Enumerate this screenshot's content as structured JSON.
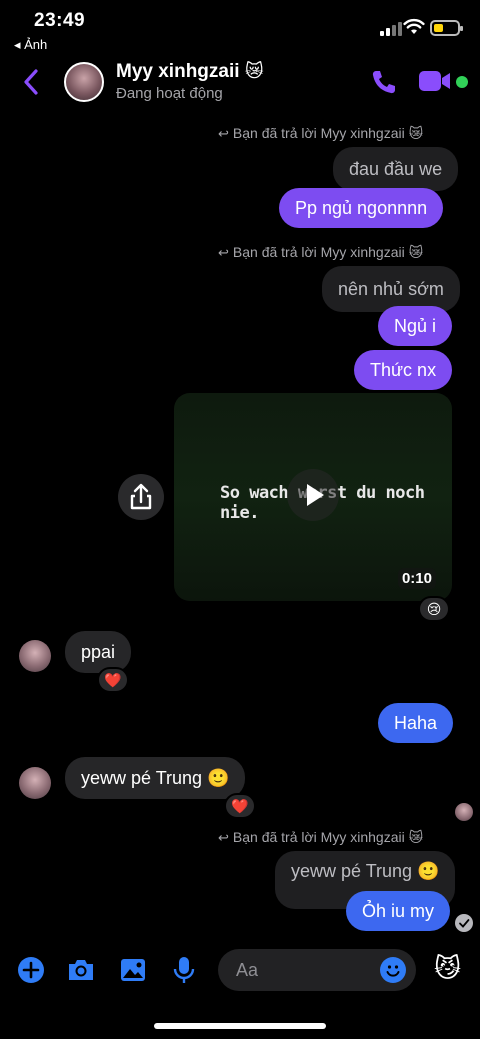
{
  "status_bar": {
    "time": "23:49",
    "back_app": "◂ Ảnh"
  },
  "header": {
    "contact_name": "Myy xinhgzaii",
    "contact_emoji": "😿",
    "contact_status": "Đang hoạt động",
    "accent_color": "#8a4dfc"
  },
  "messages": {
    "reply1_label": "Bạn đã trả lời Myy xinhgzaii 😿",
    "quote1": "đau đầu we",
    "msg1": "Pp ngủ ngonnnn",
    "reply2_label": "Bạn đã trả lời Myy xinhgzaii 😿",
    "quote2": "nên nhủ sớm",
    "msg2": "Ngủ i",
    "msg3": "Thức nx",
    "video": {
      "caption": "So wach warst du noch nie.",
      "duration": "0:10",
      "reaction": "😢"
    },
    "in1": {
      "text": "ppai",
      "reaction": "❤️"
    },
    "msg4": "Haha",
    "in2": {
      "text": "yeww pé Trung 🙂",
      "reaction": "❤️"
    },
    "reply3_label": "Bạn đã trả lời Myy xinhgzaii 😿",
    "quote3": "yeww pé Trung 🙂",
    "msg5": "Ỏh iu my"
  },
  "composer": {
    "placeholder": "Aa",
    "like_emoji": "😼"
  },
  "colors": {
    "purple_bubble": "#7d4cf1",
    "blue_bubble": "#3d68f0",
    "icon_blue": "#2f7cf6"
  }
}
